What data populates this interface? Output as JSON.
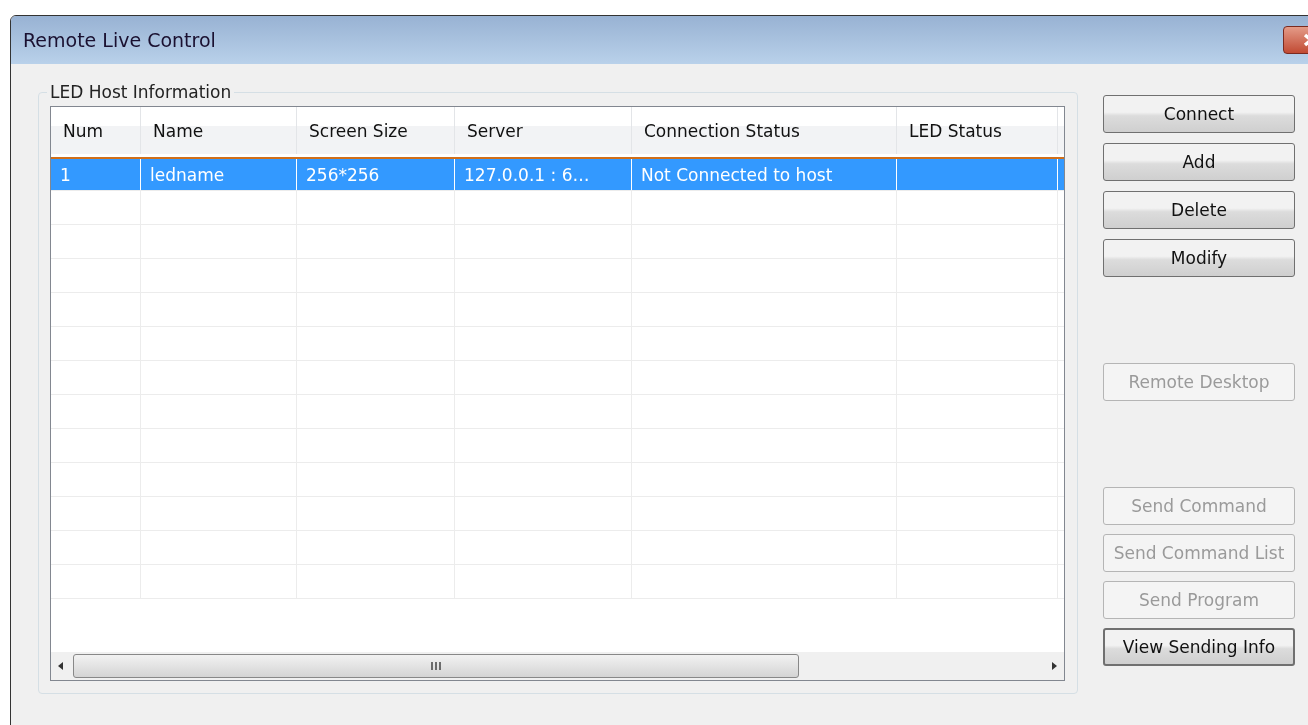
{
  "window": {
    "title": "Remote Live Control"
  },
  "group_box": {
    "title": "LED Host Information"
  },
  "table": {
    "columns": [
      "Num",
      "Name",
      "Screen Size",
      "Server",
      "Connection Status",
      "LED Status"
    ],
    "rows": [
      {
        "cells": [
          "1",
          "ledname",
          "256*256",
          "127.0.0.1 : 6…",
          "Not Connected to host",
          ""
        ],
        "selected": true
      }
    ]
  },
  "button_groups": [
    [
      {
        "label": "Connect",
        "disabled": false
      },
      {
        "label": "Add",
        "disabled": false
      },
      {
        "label": "Delete",
        "disabled": false
      },
      {
        "label": "Modify",
        "disabled": false
      }
    ],
    [
      {
        "label": "Remote Desktop",
        "disabled": true
      }
    ],
    [
      {
        "label": "Send Command",
        "disabled": true
      },
      {
        "label": "Send Command List",
        "disabled": true
      },
      {
        "label": "Send Program",
        "disabled": true
      },
      {
        "label": "View Sending Info",
        "disabled": false,
        "focused": true
      }
    ]
  ]
}
